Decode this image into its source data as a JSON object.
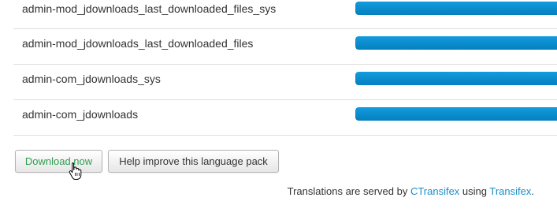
{
  "rows": [
    {
      "name": "admin-mod_jdownloads_last_downloaded_files_sys",
      "progress": 1.0
    },
    {
      "name": "admin-mod_jdownloads_last_downloaded_files",
      "progress": 1.0
    },
    {
      "name": "admin-com_jdownloads_sys",
      "progress": 1.0
    },
    {
      "name": "admin-com_jdownloads",
      "progress": 1.0
    }
  ],
  "actions": {
    "download_label": "Download now",
    "help_label": "Help improve this language pack"
  },
  "footer": {
    "prefix": "Translations are served by ",
    "link1": "CTransifex",
    "middle": " using ",
    "link2": "Transifex",
    "suffix": "."
  },
  "colors": {
    "progress_fill": "#149bdf",
    "download_text": "#2f9e4f",
    "link": "#1a8fc9"
  },
  "icons": {
    "cursor": "hand-pointer-icon"
  }
}
